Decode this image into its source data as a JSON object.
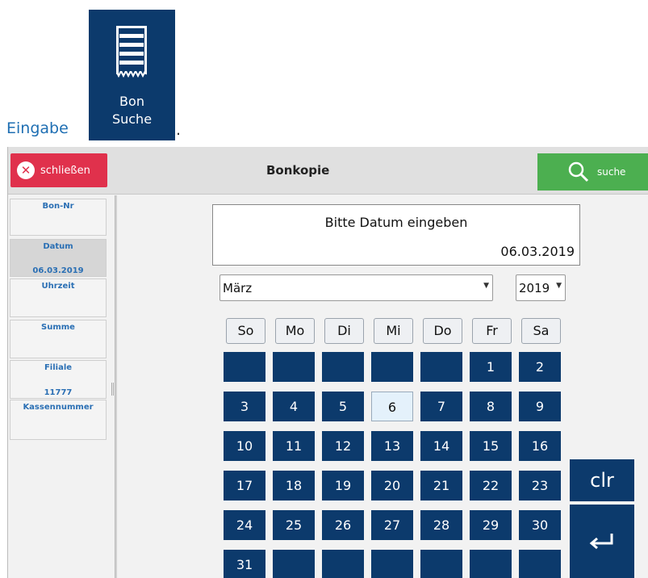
{
  "doc": {
    "prefix": "Eingabe",
    "suffix": ".",
    "icon": {
      "name": "receipt-icon",
      "line1": "Bon",
      "line2": "Suche"
    }
  },
  "header": {
    "close_label": "schließen",
    "title": "Bonkopie",
    "search_label": "suche"
  },
  "sidebar": {
    "items": [
      {
        "label": "Bon-Nr",
        "value": ""
      },
      {
        "label": "Datum",
        "value": "06.03.2019"
      },
      {
        "label": "Uhrzeit",
        "value": ""
      },
      {
        "label": "Summe",
        "value": ""
      },
      {
        "label": "Filiale",
        "value": "11777"
      },
      {
        "label": "Kassennummer",
        "value": ""
      }
    ]
  },
  "display": {
    "prompt": "Bitte Datum eingeben",
    "date": "06.03.2019"
  },
  "month_select": {
    "value": "März"
  },
  "year_select": {
    "value": "2019"
  },
  "weekdays": [
    "So",
    "Mo",
    "Di",
    "Mi",
    "Do",
    "Fr",
    "Sa"
  ],
  "calendar_rows": [
    [
      "",
      "",
      "",
      "",
      "",
      "1",
      "2"
    ],
    [
      "3",
      "4",
      "5",
      "6",
      "7",
      "8",
      "9"
    ],
    [
      "10",
      "11",
      "12",
      "13",
      "14",
      "15",
      "16"
    ],
    [
      "17",
      "18",
      "19",
      "20",
      "21",
      "22",
      "23"
    ],
    [
      "24",
      "25",
      "26",
      "27",
      "28",
      "29",
      "30"
    ],
    [
      "31",
      "",
      "",
      "",
      "",
      "",
      ""
    ]
  ],
  "selected_day": "6",
  "keypad": {
    "clear_label": "clr",
    "enter_icon": "enter-icon"
  },
  "colors": {
    "navy": "#0c3a6c",
    "close_red": "#e0314c",
    "search_green": "#4caf50",
    "label_blue": "#2a6fb4"
  }
}
